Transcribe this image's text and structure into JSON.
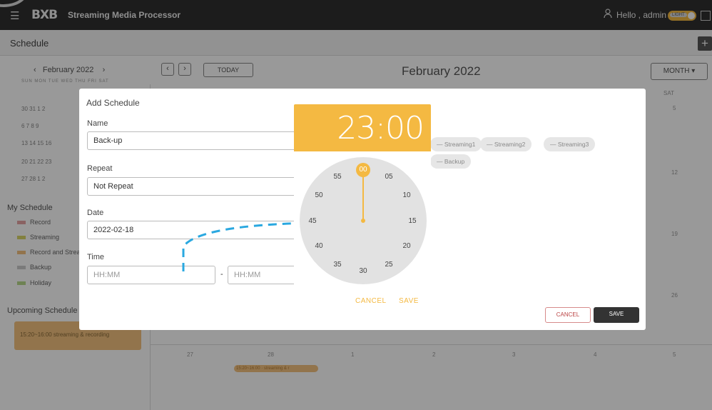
{
  "topbar": {
    "brand": "BXB",
    "app_name": "Streaming Media Processor",
    "greeting": "Hello , admin",
    "theme_toggle_label": "LIGHT",
    "menu_icon": "hamburger-icon",
    "user_icon": "user-icon",
    "expand_icon": "expand-icon"
  },
  "subbar": {
    "title": "Schedule",
    "add_label": "+"
  },
  "mini_calendar": {
    "month": "February 2022",
    "prev": "‹",
    "next": "›",
    "weekdays": "SUN  MON  TUE  WED  THU  FRI  SAT",
    "rows": [
      "30  31   1   2",
      "6   7   8   9",
      "13  14  15  16",
      "20  21  22  23",
      "27  28   1   2"
    ]
  },
  "my_schedule": {
    "title": "My Schedule",
    "items": [
      {
        "label": "Record",
        "color": "#e6a3a3"
      },
      {
        "label": "Streaming",
        "color": "#d9d56a"
      },
      {
        "label": "Record and Streaming",
        "color": "#f3c27f"
      },
      {
        "label": "Backup",
        "color": "#cccccc"
      },
      {
        "label": "Holiday",
        "color": "#b7d98a"
      }
    ]
  },
  "upcoming": {
    "title": "Upcoming Schedule",
    "card": "15:20~16:00  streaming & recording"
  },
  "toolbar": {
    "prev": "‹",
    "next": "›",
    "today": "TODAY",
    "title": "February 2022",
    "view": "MONTH  ▾"
  },
  "calendar": {
    "sat_header": "SAT",
    "sat_days": [
      "5",
      "12",
      "19",
      "26"
    ],
    "last_row": [
      "27",
      "28",
      "1",
      "2",
      "3",
      "4",
      "5"
    ],
    "event": "15:20~16:00 · streaming & r"
  },
  "dialog": {
    "title": "Add Schedule",
    "name_label": "Name",
    "name_value": "Back-up",
    "repeat_label": "Repeat",
    "repeat_value": "Not Repeat",
    "date_label": "Date",
    "date_value": "2022-02-18",
    "time_label": "Time",
    "time_start_placeholder": "HH:MM",
    "time_sep": "-",
    "time_end_placeholder": "HH:MM",
    "chips": [
      "— Streaming1",
      "— Streaming2",
      "— Streaming3",
      "— Backup"
    ],
    "cancel": "CANCEL",
    "save": "SAVE"
  },
  "picker": {
    "time": "23:00",
    "selected_minute": "00",
    "minutes": [
      "05",
      "10",
      "15",
      "20",
      "25",
      "30",
      "35",
      "40",
      "45",
      "50",
      "55"
    ],
    "cancel": "CANCEL",
    "save": "SAVE",
    "accent": "#f4b942"
  }
}
